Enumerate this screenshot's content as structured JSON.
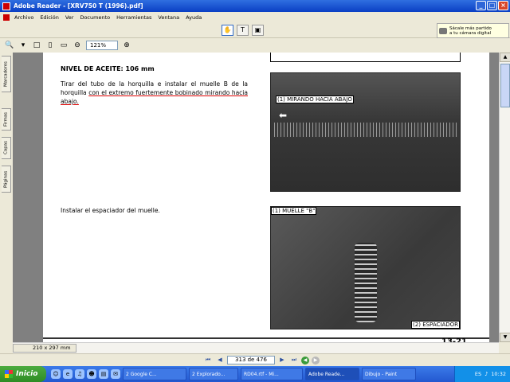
{
  "window": {
    "title": "Adobe Reader - [XRV750 T (1996).pdf]"
  },
  "menu": [
    "Archivo",
    "Edición",
    "Ver",
    "Documento",
    "Herramientas",
    "Ventana",
    "Ayuda"
  ],
  "camera_promo": {
    "line1": "Sácale más partido",
    "line2": "a tu cámara digital"
  },
  "zoom": {
    "value": "121%"
  },
  "side_tabs": [
    "Marcadores",
    "Firmas",
    "Capas",
    "Páginas"
  ],
  "document": {
    "heading": "NIVEL DE ACEITE: 106 mm",
    "para1_plain": "Tirar del tubo de la horquilla e instalar el muelle B de la horquilla ",
    "para1_underlined": "con el extremo fuertemente bobinado mirando hacia abajo.",
    "para2": "Instalar el espaciador del muelle.",
    "photo1_label": "(1) MIRANDO HACIA ABAJO",
    "photo2_label1": "(1) MUELLE \"B\"",
    "photo2_label2": "(2) ESPACIADOR",
    "page_footer": "13-21"
  },
  "page_size": "210 x 297 mm",
  "navigation": {
    "page_indicator": "313 de 476"
  },
  "taskbar": {
    "start": "Inicio",
    "tasks": [
      "2 Google C...",
      "2 Explorado...",
      "RD04.rtf - Mi...",
      "Adobe Reade...",
      "Dibujo - Paint"
    ],
    "language": "ES",
    "clock": "10:32"
  }
}
